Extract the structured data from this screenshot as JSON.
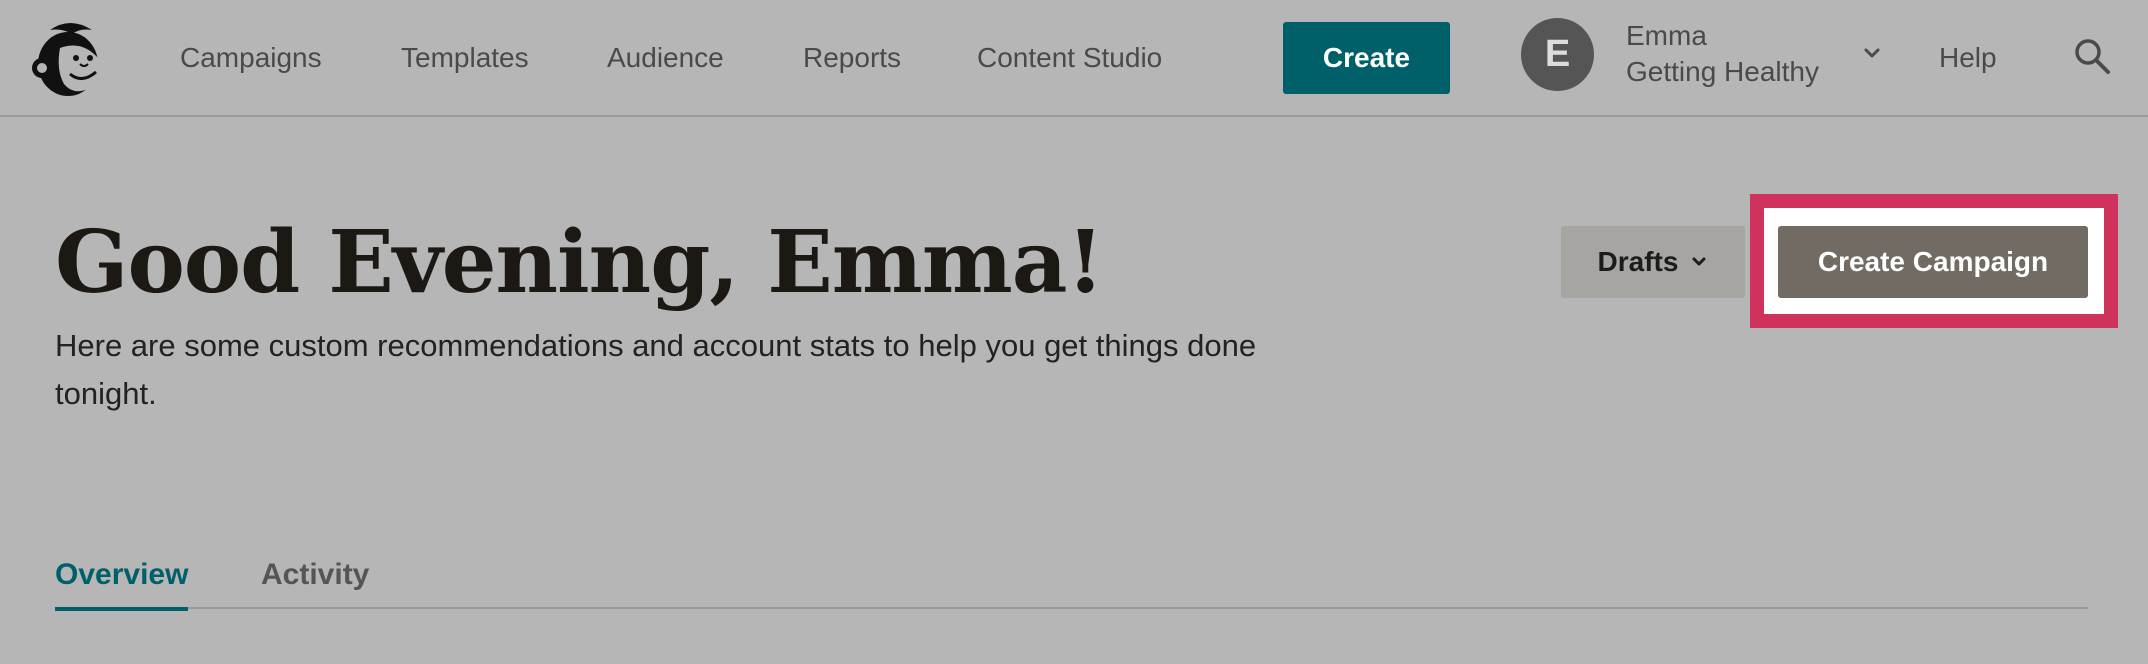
{
  "nav": {
    "links": [
      "Campaigns",
      "Templates",
      "Audience",
      "Reports",
      "Content Studio"
    ],
    "create_label": "Create",
    "help_label": "Help"
  },
  "account": {
    "avatar_initial": "E",
    "name": "Emma",
    "organization": "Getting Healthy"
  },
  "header": {
    "greeting": "Good Evening, Emma!",
    "subtitle": "Here are some custom recommendations and account stats to help you get things done tonight.",
    "drafts_label": "Drafts",
    "create_campaign_label": "Create Campaign"
  },
  "tabs": [
    {
      "label": "Overview",
      "active": true
    },
    {
      "label": "Activity",
      "active": false
    }
  ],
  "colors": {
    "accent": "#00606a",
    "highlight": "#d0325e",
    "primary_button": "#716b64",
    "background": "#b6b6b6"
  },
  "icons": {
    "logo": "mailchimp-freddie-logo",
    "account_menu": "chevron-down-icon",
    "drafts_menu": "chevron-down-icon",
    "search": "search-icon"
  }
}
